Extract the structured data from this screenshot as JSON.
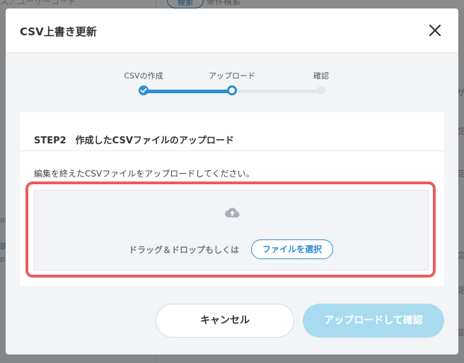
{
  "background": {
    "fragment_left": "ス／ユーザーコード",
    "search_pill": "検索",
    "condition_search": "条件検索",
    "right_fragments": [
      "ザ",
      "定",
      "定",
      "定",
      "定",
      "定"
    ],
    "left_fragments": [
      "oh",
      "説",
      "p"
    ]
  },
  "modal": {
    "title": "CSV上書き更新",
    "close_label": "閉じる"
  },
  "stepper": {
    "steps": [
      {
        "label": "CSVの作成",
        "status": "completed"
      },
      {
        "label": "アップロード",
        "status": "current"
      },
      {
        "label": "確認",
        "status": "pending"
      }
    ],
    "colors": {
      "active": "#2d8fcf",
      "inactive": "#e3e7eb"
    }
  },
  "card": {
    "title": "STEP2　作成したCSVファイルのアップロード",
    "description": "編集を終えたCSVファイルをアップロードしてください。",
    "dropzone": {
      "text": "ドラッグ＆ドロップもしくは",
      "button_label": "ファイルを選択"
    }
  },
  "footer": {
    "cancel_label": "キャンセル",
    "confirm_label": "アップロードして確認"
  },
  "colors": {
    "accent": "#2d8fcf",
    "highlight": "#ee5b5b",
    "confirm_disabled": "#a8dbf0"
  }
}
